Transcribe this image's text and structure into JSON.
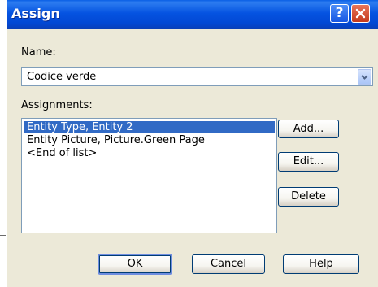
{
  "dialog": {
    "title": "Assign",
    "help_glyph": "?",
    "name_label": "Name:",
    "name_value": "Codice verde",
    "assignments_label": "Assignments:",
    "assignments": [
      "Entity Type, Entity 2",
      "Entity Picture, Picture.Green Page",
      "<End of list>"
    ],
    "selected_index": 0,
    "side_buttons": {
      "add": "Add...",
      "edit": "Edit...",
      "delete": "Delete"
    },
    "footer_buttons": {
      "ok": "OK",
      "cancel": "Cancel",
      "help": "Help"
    }
  },
  "colors": {
    "titlebar": "#0553e1",
    "face": "#ece9d8",
    "selection": "#316ac5",
    "close": "#c4391b"
  },
  "icons": {
    "help": "help-icon",
    "close": "close-icon",
    "dropdown": "chevron-down-icon"
  }
}
